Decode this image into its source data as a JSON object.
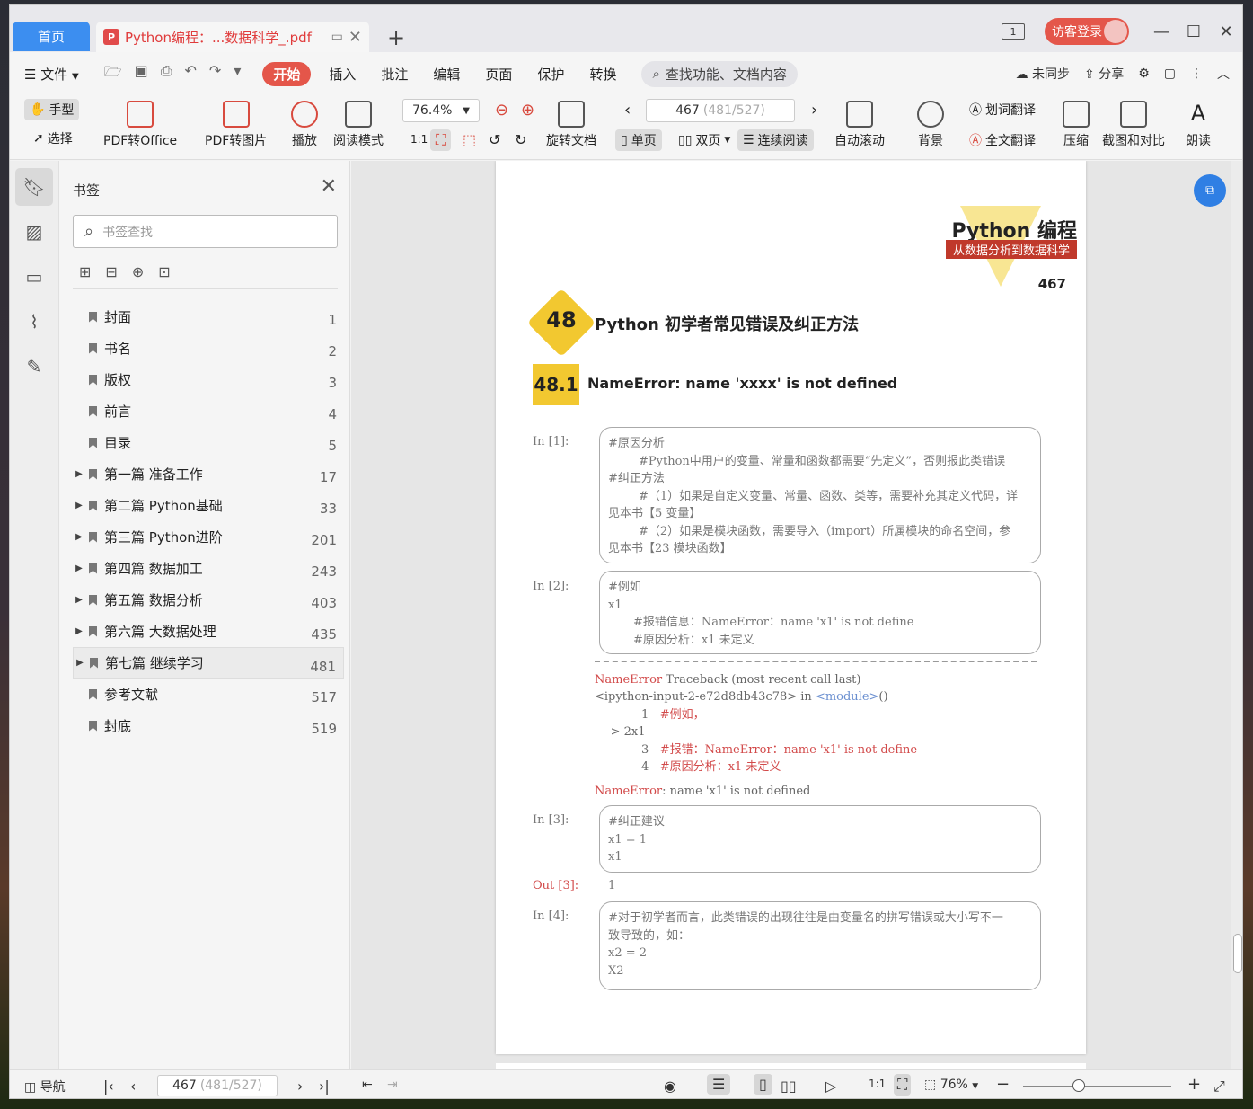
{
  "titlebar": {
    "home_tab": "首页",
    "doc_tab": "Python编程：...数据科学_.pdf",
    "pdf_badge": "P",
    "login": "访客登录",
    "mode_icon": "1"
  },
  "menu": {
    "file": "文件",
    "items": [
      "开始",
      "插入",
      "批注",
      "编辑",
      "页面",
      "保护",
      "转换"
    ],
    "search": "查找功能、文档内容",
    "sync": "未同步",
    "share": "分享"
  },
  "ribbon": {
    "hand": "手型",
    "select": "选择",
    "pdf_office": "PDF转Office",
    "pdf_image": "PDF转图片",
    "play": "播放",
    "read_mode": "阅读模式",
    "zoom": "76.4%",
    "rotate": "旋转文档",
    "page_current": "467",
    "page_total": "(481/527)",
    "single": "单页",
    "double": "双页",
    "continuous": "连续阅读",
    "autoscroll": "自动滚动",
    "background": "背景",
    "word_translate": "划词翻译",
    "full_translate": "全文翻译",
    "compress": "压缩",
    "screenshot": "截图和对比",
    "read_aloud": "朗读"
  },
  "bookmarks": {
    "title": "书签",
    "search_placeholder": "书签查找",
    "items": [
      {
        "label": "封面",
        "page": "1"
      },
      {
        "label": "书名",
        "page": "2"
      },
      {
        "label": "版权",
        "page": "3"
      },
      {
        "label": "前言",
        "page": "4"
      },
      {
        "label": "目录",
        "page": "5"
      },
      {
        "label": "第一篇  准备工作",
        "page": "17"
      },
      {
        "label": "第二篇  Python基础",
        "page": "33"
      },
      {
        "label": "第三篇  Python进阶",
        "page": "201"
      },
      {
        "label": "第四篇  数据加工",
        "page": "243"
      },
      {
        "label": "第五篇  数据分析",
        "page": "403"
      },
      {
        "label": "第六篇  大数据处理",
        "page": "435"
      },
      {
        "label": "第七篇  继续学习",
        "page": "481"
      },
      {
        "label": "参考文献",
        "page": "517"
      },
      {
        "label": "封底",
        "page": "519"
      }
    ]
  },
  "page": {
    "logo_title": "Python 编程",
    "logo_subtitle": "从数据分析到数据科学",
    "page_number": "467",
    "chapter_num": "48",
    "chapter_title": "Python 初学者常见错误及纠正方法",
    "section_num": "48.1",
    "section_title": "NameError: name 'xxxx' is not defined",
    "in1_label": "In [1]:",
    "in1_lines": [
      "#原因分析",
      "#Python中用户的变量、常量和函数都需要“先定义”，否则报此类错误",
      "#纠正方法",
      "#（1）如果是自定义变量、常量、函数、类等，需要补充其定义代码，详",
      "见本书【5 变量】",
      "#（2）如果是模块函数，需要导入（import）所属模块的命名空间，参",
      "见本书【23 模块函数】"
    ],
    "in2_label": "In [2]:",
    "in2_lines": [
      "#例如",
      "x1",
      "#报错信息：NameError：name 'x1' is not define",
      "#原因分析：x1 未定义"
    ],
    "tb_error": "NameError",
    "tb_rest": " Traceback (most recent call last)",
    "tb_loc": "<ipython-input-2-e72d8db43c78> in ",
    "tb_module": "<module>",
    "tb_paren": "()",
    "tb_line1_no": "1",
    "tb_line1": "#例如，",
    "tb_arrow": "----> 2x1",
    "tb_line3_no": "3",
    "tb_line3": "#报错：NameError：name 'x1' is not define",
    "tb_line4_no": "4",
    "tb_line4": "#原因分析：x1 未定义",
    "tb_final_err": "NameError",
    "tb_final_msg": ": name 'x1' is not defined",
    "in3_label": "In [3]:",
    "in3_lines": [
      "#纠正建议",
      "x1 = 1",
      "x1"
    ],
    "out3_label": "Out [3]:",
    "out3_value": "1",
    "in4_label": "In [4]:",
    "in4_lines": [
      "#对于初学者而言，此类错误的出现往往是由变量名的拼写错误或大小写不一",
      "致导致的，如：",
      "x2 = 2",
      "X2"
    ]
  },
  "status": {
    "nav": "导航",
    "page_current": "467",
    "page_total": "(481/527)",
    "zoom": "76%"
  }
}
